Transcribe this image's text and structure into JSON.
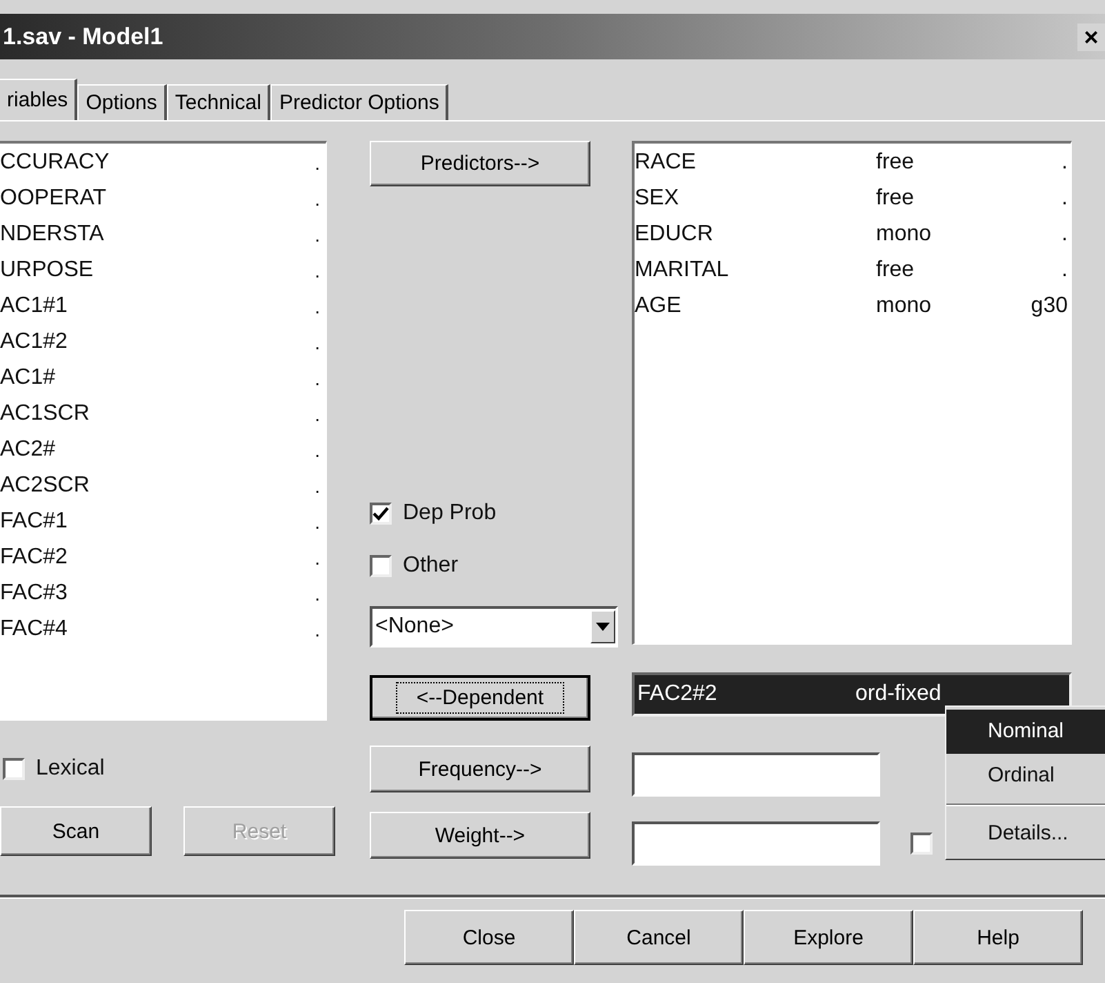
{
  "window": {
    "title": "1.sav - Model1",
    "close": "×"
  },
  "tabs": [
    {
      "label": "riables",
      "selected": true
    },
    {
      "label": "Options",
      "selected": false
    },
    {
      "label": "Technical",
      "selected": false
    },
    {
      "label": "Predictor Options",
      "selected": false
    }
  ],
  "variables": [
    {
      "name": "CCURACY",
      "mark": "."
    },
    {
      "name": "OOPERAT",
      "mark": "."
    },
    {
      "name": "NDERSTA",
      "mark": "."
    },
    {
      "name": "URPOSE",
      "mark": "."
    },
    {
      "name": "AC1#1",
      "mark": "."
    },
    {
      "name": "AC1#2",
      "mark": "."
    },
    {
      "name": "AC1#",
      "mark": "."
    },
    {
      "name": "AC1SCR",
      "mark": "."
    },
    {
      "name": "AC2#",
      "mark": "."
    },
    {
      "name": "AC2SCR",
      "mark": "."
    },
    {
      "name": "FAC#1",
      "mark": "."
    },
    {
      "name": "FAC#2",
      "mark": "."
    },
    {
      "name": "FAC#3",
      "mark": "."
    },
    {
      "name": "FAC#4",
      "mark": "."
    }
  ],
  "predictors_button": {
    "label": "Predictors-->",
    "focused": false
  },
  "predictors": [
    {
      "name": "RACE",
      "type": "free",
      "level": "."
    },
    {
      "name": "SEX",
      "type": "free",
      "level": "."
    },
    {
      "name": "EDUCR",
      "type": "mono",
      "level": "."
    },
    {
      "name": "MARITAL",
      "type": "free",
      "level": "."
    },
    {
      "name": "AGE",
      "type": "mono",
      "level": "g30"
    }
  ],
  "options": [
    {
      "label": "Dep Prob",
      "checked": true
    },
    {
      "label": "Other",
      "checked": false
    }
  ],
  "combo": {
    "value": "<None>"
  },
  "dependent_button": {
    "label": "<--Dependent",
    "focused": true
  },
  "dependent": {
    "name": "FAC2#2",
    "type": "ord-fixed"
  },
  "lexical": {
    "label": "Lexical",
    "checked": false
  },
  "scan_buttons": [
    {
      "label": "Scan",
      "disabled": false
    },
    {
      "label": "Reset",
      "disabled": true
    }
  ],
  "frequency_button": {
    "label": "Frequency-->",
    "focused": false
  },
  "weight_button": {
    "label": "Weight-->",
    "focused": false
  },
  "weight_check": {
    "checked": false
  },
  "menu": [
    {
      "kind": "item",
      "label": "Nominal",
      "selected": true
    },
    {
      "kind": "item",
      "label": "Ordinal",
      "selected": false
    },
    {
      "kind": "separator"
    },
    {
      "kind": "item",
      "label": "Details...",
      "selected": false
    }
  ],
  "footer_buttons": [
    "Close",
    "Cancel",
    "Explore",
    "Help"
  ]
}
